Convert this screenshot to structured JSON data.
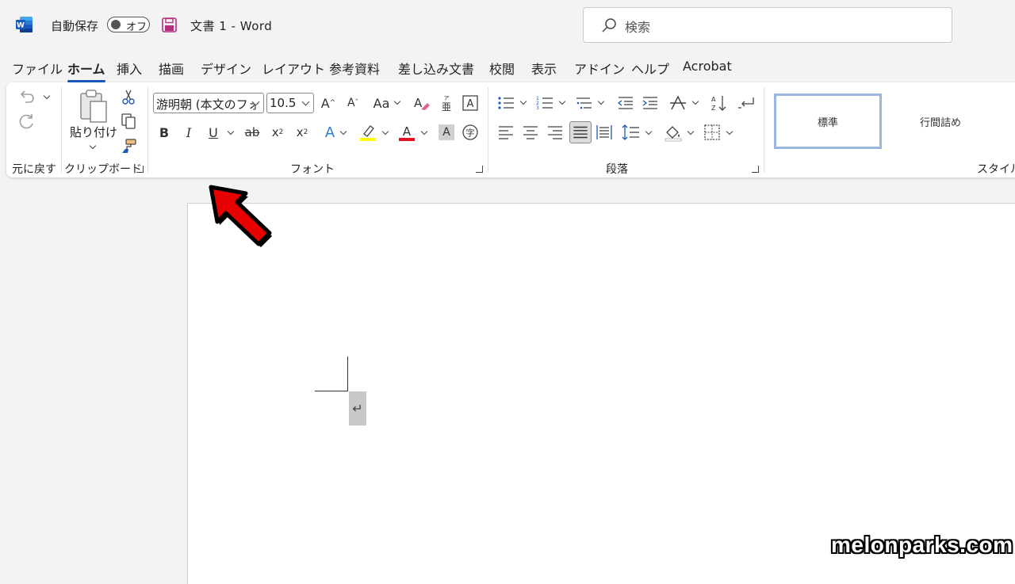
{
  "titlebar": {
    "autosave_label": "自動保存",
    "autosave_state": "オフ",
    "doc_title": "文書 1  -  Word",
    "search_placeholder": "検索"
  },
  "tabs": [
    "ファイル",
    "ホーム",
    "挿入",
    "描画",
    "デザイン",
    "レイアウト",
    "参考資料",
    "差し込み文書",
    "校閲",
    "表示",
    "アドイン",
    "ヘルプ",
    "Acrobat"
  ],
  "active_tab": "ホーム",
  "ribbon": {
    "groups": {
      "undo": "元に戻す",
      "clipboard": "クリップボード",
      "font": "フォント",
      "paragraph": "段落",
      "styles": "スタイル"
    },
    "paste_label": "貼り付け",
    "font_name": "游明朝 (本文のフォ",
    "font_size": "10.5",
    "change_case": "Aa",
    "styles": [
      "標準",
      "行間詰め"
    ]
  },
  "document": {
    "paragraph_mark": "↵"
  },
  "watermark": "melonparks.com",
  "colors": {
    "accent": "#185abd",
    "word_blue": "#2b579a",
    "highlight": "#ffff00",
    "font_color": "#e81123",
    "annotation_arrow": "#e60000"
  }
}
